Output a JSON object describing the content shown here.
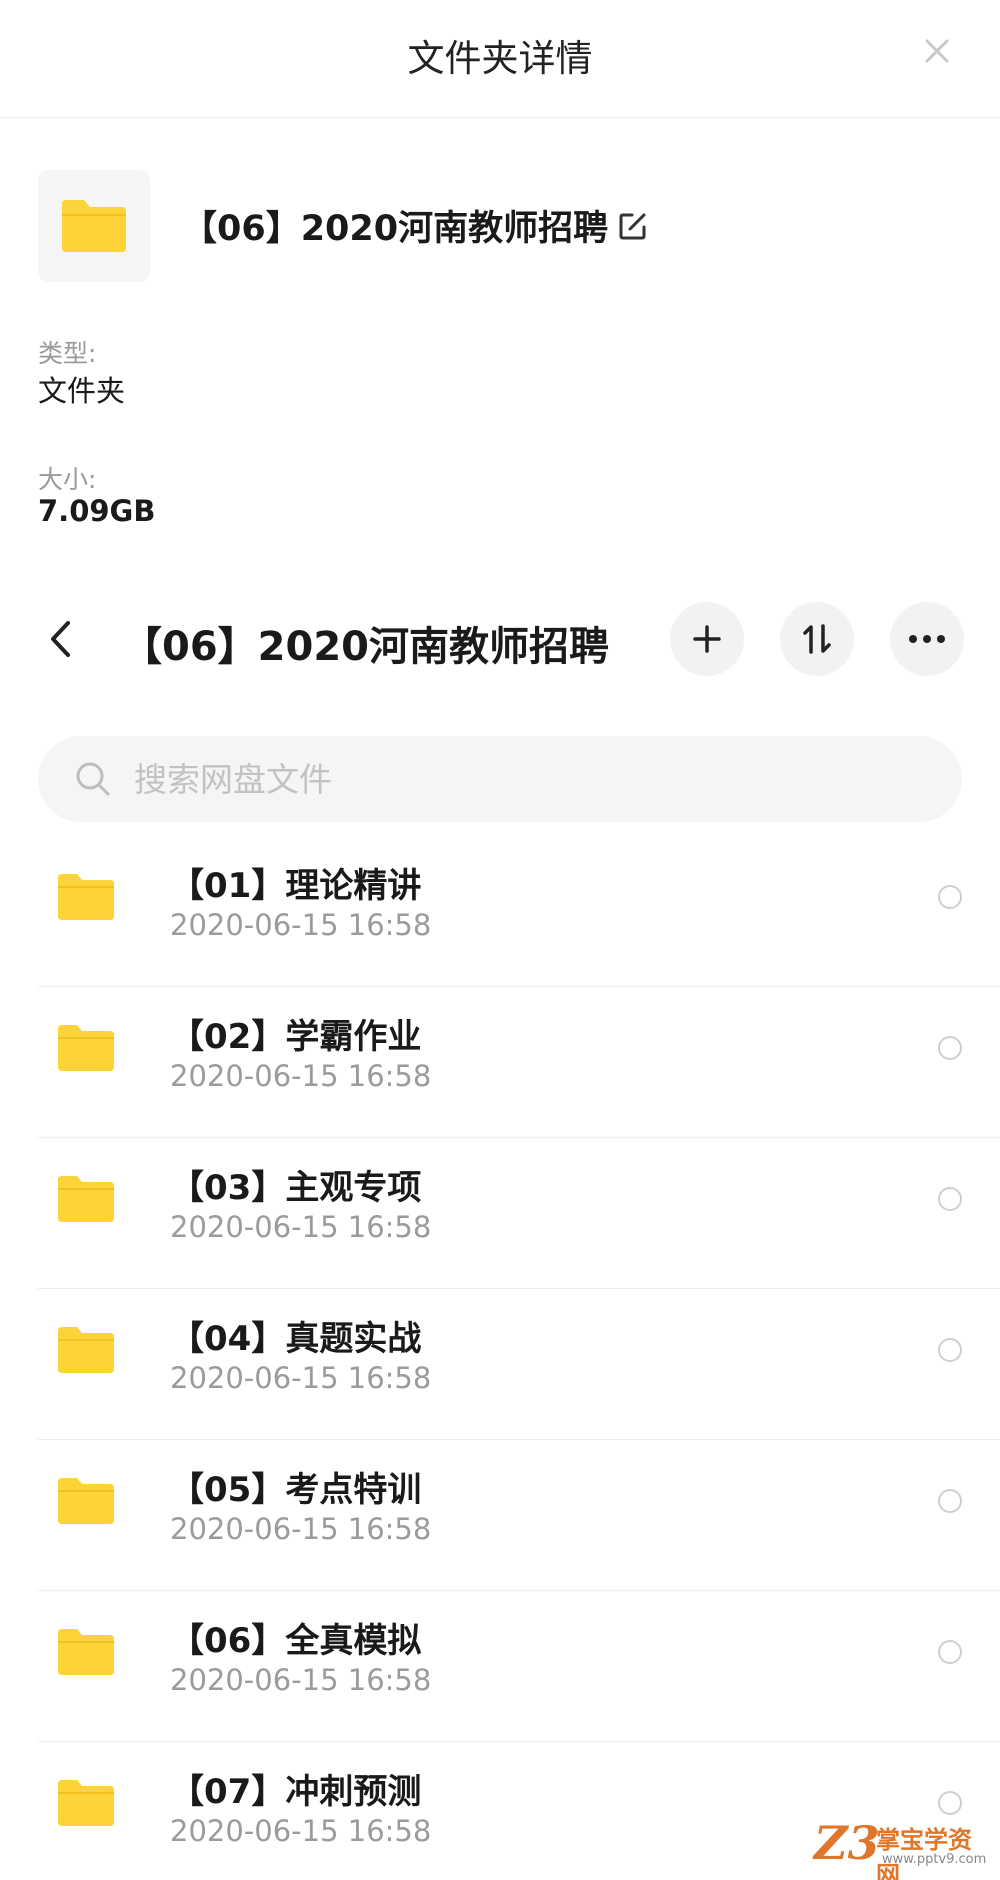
{
  "header": {
    "title": "文件夹详情"
  },
  "info": {
    "name": "【06】2020河南教师招聘",
    "type_label": "类型:",
    "type_value": "文件夹",
    "size_label": "大小:",
    "size_value": "7.09GB"
  },
  "nav": {
    "title": "【06】2020河南教师招聘"
  },
  "search": {
    "placeholder": "搜索网盘文件"
  },
  "files": [
    {
      "name": "【01】理论精讲",
      "date": "2020-06-15  16:58"
    },
    {
      "name": "【02】学霸作业",
      "date": "2020-06-15  16:58"
    },
    {
      "name": "【03】主观专项",
      "date": "2020-06-15  16:58"
    },
    {
      "name": "【04】真题实战",
      "date": "2020-06-15  16:58"
    },
    {
      "name": "【05】考点特训",
      "date": "2020-06-15  16:58"
    },
    {
      "name": "【06】全真模拟",
      "date": "2020-06-15  16:58"
    },
    {
      "name": "【07】冲刺预测",
      "date": "2020-06-15  16:58"
    }
  ],
  "watermark": {
    "logo": "Z3",
    "name": "掌宝学资网",
    "url": "www.pptv9.com"
  },
  "colors": {
    "folder": "#fdd33a",
    "muted": "#9b9b9b",
    "accent": "#e0762b"
  },
  "icons": {
    "close": "close-icon",
    "folder": "folder-icon",
    "edit": "edit-icon",
    "back": "chevron-left-icon",
    "add": "plus-icon",
    "sort": "sort-icon",
    "more": "more-icon",
    "search": "search-icon"
  }
}
